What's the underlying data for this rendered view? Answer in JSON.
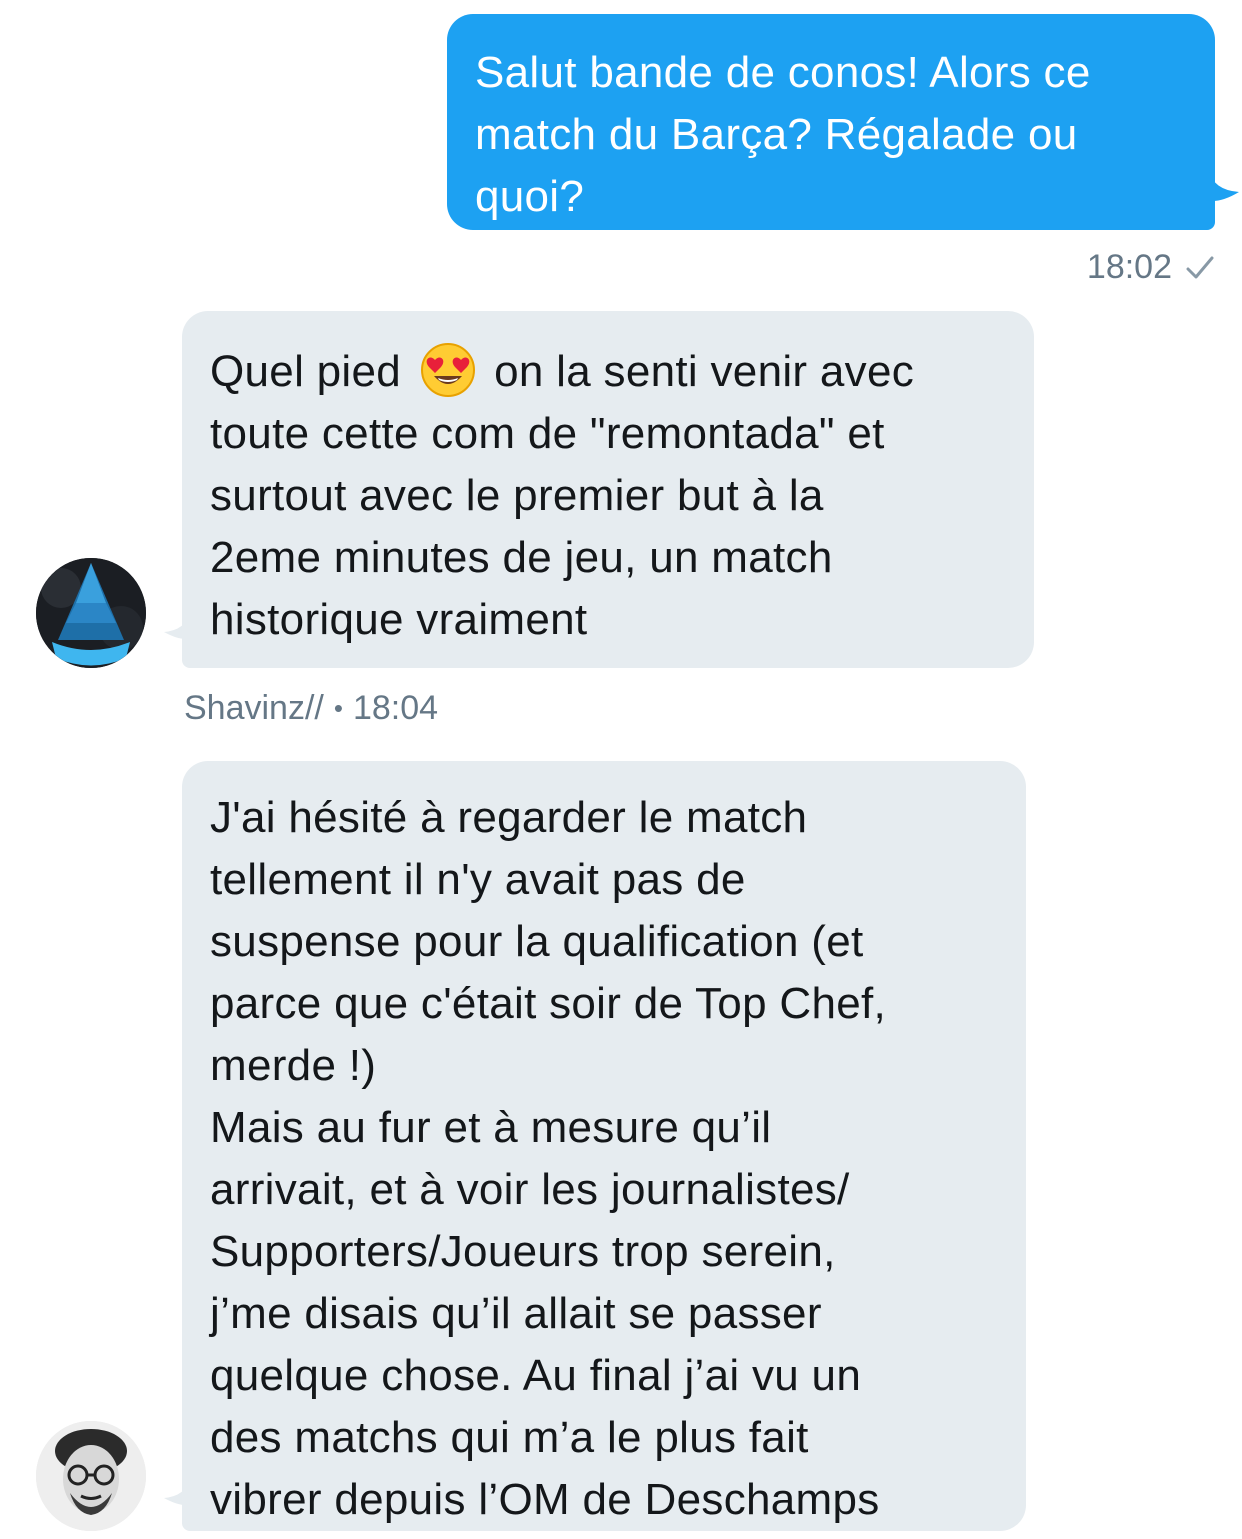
{
  "messages": [
    {
      "direction": "outgoing",
      "text": "Salut bande de conos! Alors ce\nmatch du Barça? Régalade ou\nquoi?",
      "time": "18:02",
      "status_icon": "checkmark-icon"
    },
    {
      "direction": "incoming",
      "text_before_emoji": "Quel pied ",
      "emoji": "heart-eyes-emoji",
      "text_after_emoji": " on la senti venir avec\ntoute cette com de \"remontada\" et\nsurtout avec le premier but à la\n2eme minutes de jeu, un match\nhistorique vraiment",
      "sender": "Shavinz//",
      "separator": "•",
      "time": "18:04"
    },
    {
      "direction": "incoming",
      "text": "J'ai hésité à regarder le match\ntellement il n'y avait pas de\nsuspense pour la qualification (et\nparce que c'était soir de Top Chef,\nmerde !)\nMais au fur et à mesure qu’il\narrivait, et à voir les journalistes/\nSupporters/Joueurs trop serein,\nj’me disais qu’il allait se passer\nquelque chose. Au final j’ai vu un\ndes matchs qui m’a le plus fait\nvibrer depuis l’OM de Deschamps"
    }
  ],
  "colors": {
    "outgoing_bubble": "#1da1f2",
    "incoming_bubble": "#e6ecf0",
    "meta_text": "#657786"
  }
}
